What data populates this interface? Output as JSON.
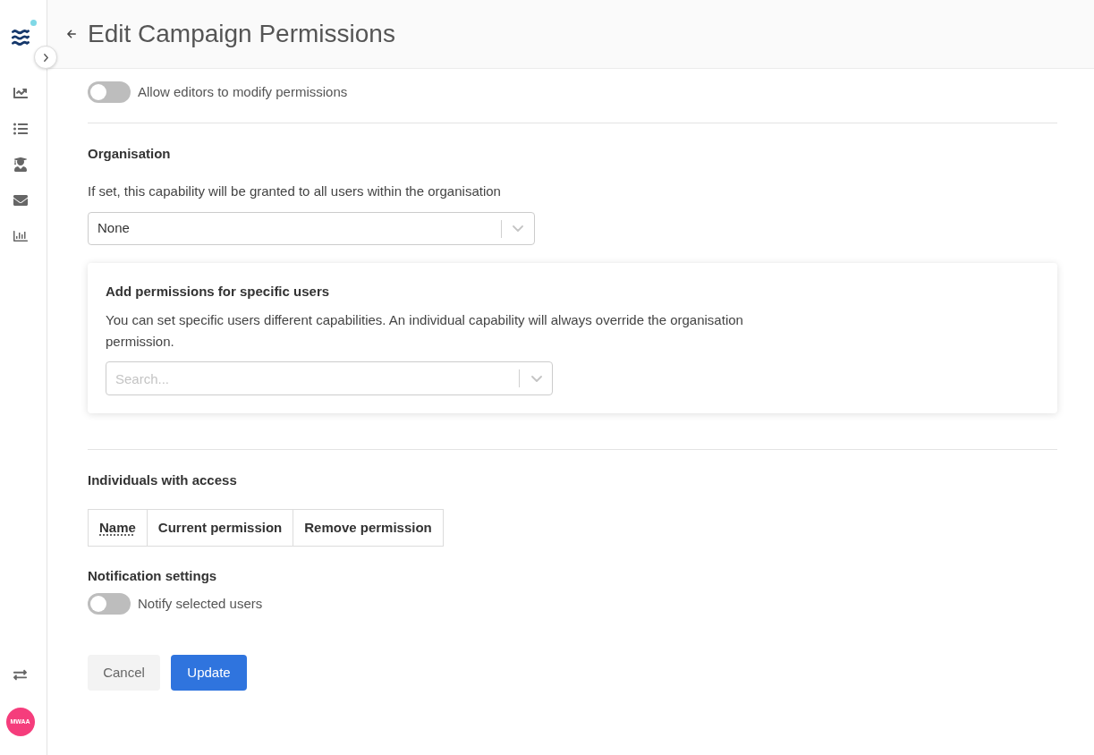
{
  "sidebar": {
    "logo_status_dot": true,
    "avatar": {
      "initials": "MWAA"
    }
  },
  "header": {
    "title": "Edit Campaign Permissions"
  },
  "editor_toggle": {
    "label": "Allow editors to modify permissions",
    "on": false
  },
  "organisation": {
    "heading": "Organisation",
    "description": "If set, this capability will be granted to all users within the organisation",
    "select": {
      "value": "None"
    }
  },
  "specific_users": {
    "heading": "Add permissions for specific users",
    "description": "You can set specific users different capabilities. An individual capability will always override the organisation permission.",
    "search": {
      "placeholder": "Search..."
    }
  },
  "individuals": {
    "heading": "Individuals with access",
    "table": {
      "columns": [
        {
          "label": "Name",
          "abbr": true
        },
        {
          "label": "Current permission",
          "abbr": false
        },
        {
          "label": "Remove permission",
          "abbr": false
        }
      ]
    }
  },
  "notifications": {
    "heading": "Notification settings",
    "toggle": {
      "label": "Notify selected users",
      "on": false
    }
  },
  "buttons": [
    {
      "label": "Cancel",
      "kind": "secondary"
    },
    {
      "label": "Update",
      "kind": "primary"
    }
  ]
}
